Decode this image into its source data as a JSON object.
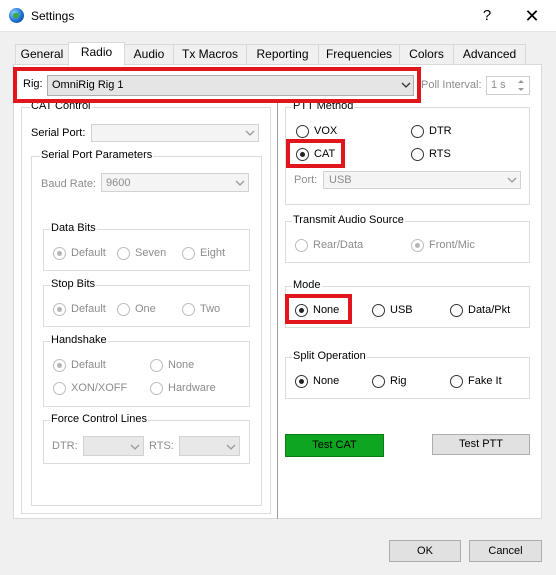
{
  "window": {
    "title": "Settings",
    "help_glyph": "?",
    "close_glyph": "✕"
  },
  "tabs": [
    {
      "label": "General"
    },
    {
      "label": "Radio"
    },
    {
      "label": "Audio"
    },
    {
      "label": "Tx Macros"
    },
    {
      "label": "Reporting"
    },
    {
      "label": "Frequencies"
    },
    {
      "label": "Colors"
    },
    {
      "label": "Advanced"
    }
  ],
  "active_tab": "Radio",
  "rig": {
    "label": "Rig:",
    "value": "OmniRig Rig 1",
    "poll_label": "Poll Interval:",
    "poll_value": "1 s"
  },
  "cat_control": {
    "title": "CAT Control",
    "serial_port_label": "Serial Port:",
    "serial_port_value": "",
    "serial_params": {
      "title": "Serial Port Parameters",
      "baud_label": "Baud Rate:",
      "baud_value": "9600",
      "data_bits": {
        "title": "Data Bits",
        "options": [
          "Default",
          "Seven",
          "Eight"
        ],
        "selected": "Default"
      },
      "stop_bits": {
        "title": "Stop Bits",
        "options": [
          "Default",
          "One",
          "Two"
        ],
        "selected": "Default"
      },
      "handshake": {
        "title": "Handshake",
        "options": [
          "Default",
          "None",
          "XON/XOFF",
          "Hardware"
        ],
        "selected": "Default"
      },
      "force_lines": {
        "title": "Force Control Lines",
        "dtr_label": "DTR:",
        "rts_label": "RTS:"
      }
    }
  },
  "ptt_method": {
    "title": "PTT Method",
    "options": [
      "VOX",
      "DTR",
      "CAT",
      "RTS"
    ],
    "selected": "CAT",
    "port_label": "Port:",
    "port_value": "USB"
  },
  "tx_audio": {
    "title": "Transmit Audio Source",
    "options": [
      "Rear/Data",
      "Front/Mic"
    ],
    "selected": "Front/Mic"
  },
  "mode": {
    "title": "Mode",
    "options": [
      "None",
      "USB",
      "Data/Pkt"
    ],
    "selected": "None"
  },
  "split": {
    "title": "Split Operation",
    "options": [
      "None",
      "Rig",
      "Fake It"
    ],
    "selected": "None"
  },
  "buttons": {
    "test_cat": "Test CAT",
    "test_ptt": "Test PTT",
    "ok": "OK",
    "cancel": "Cancel"
  },
  "colors": {
    "highlight": "#e0161c",
    "test_cat_bg": "#0ea520"
  }
}
